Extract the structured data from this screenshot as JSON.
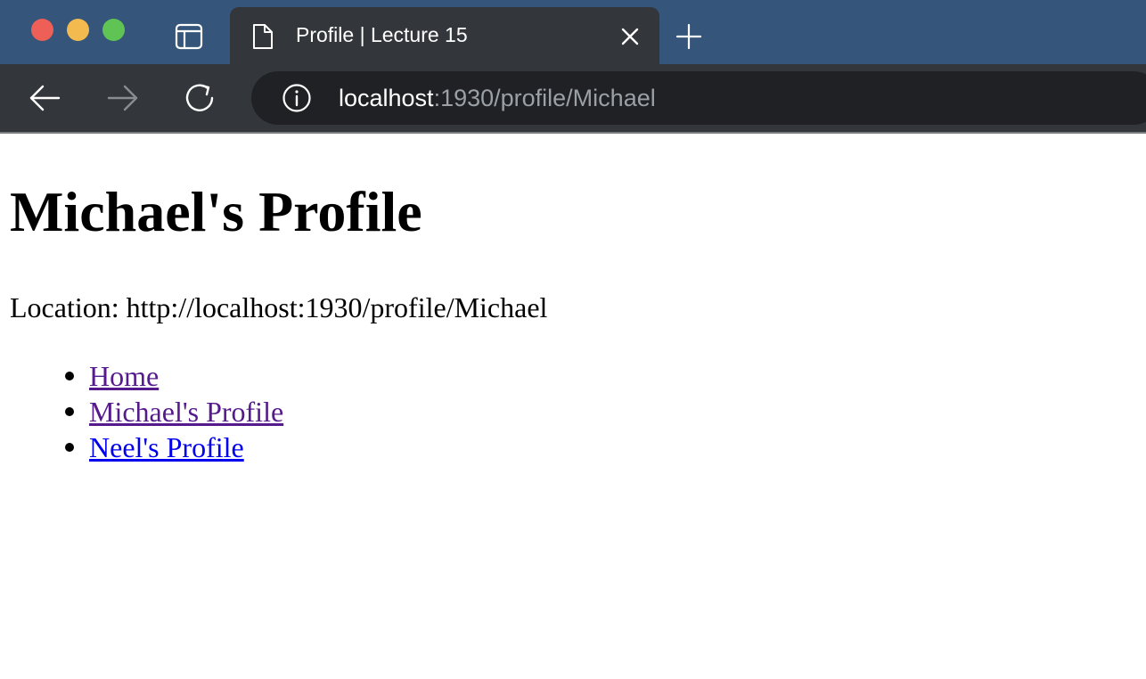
{
  "browser": {
    "tab": {
      "title": "Profile | Lecture 15"
    },
    "address": {
      "host": "localhost",
      "path": ":1930/profile/Michael"
    }
  },
  "page": {
    "heading": "Michael's Profile",
    "location_line": "Location: http://localhost:1930/profile/Michael",
    "links": [
      {
        "label": "Home",
        "visited": true
      },
      {
        "label": "Michael's Profile",
        "visited": true
      },
      {
        "label": "Neel's Profile",
        "visited": false
      }
    ]
  },
  "colors": {
    "tabbar_bg": "#35567a",
    "toolbar_bg": "#33373b",
    "addressbar_bg": "#202124",
    "link_visited": "#551a8b",
    "link_unvisited": "#0000ee"
  },
  "icons": {
    "traffic_lights": [
      "close-dot-icon",
      "minimize-dot-icon",
      "zoom-dot-icon"
    ],
    "sidebar": "sidebar-icon",
    "tab": "document-icon",
    "tab_close": "close-icon",
    "new_tab": "plus-icon",
    "back": "arrow-left-icon",
    "forward": "arrow-right-icon",
    "reload": "reload-icon",
    "site_info": "info-icon"
  }
}
